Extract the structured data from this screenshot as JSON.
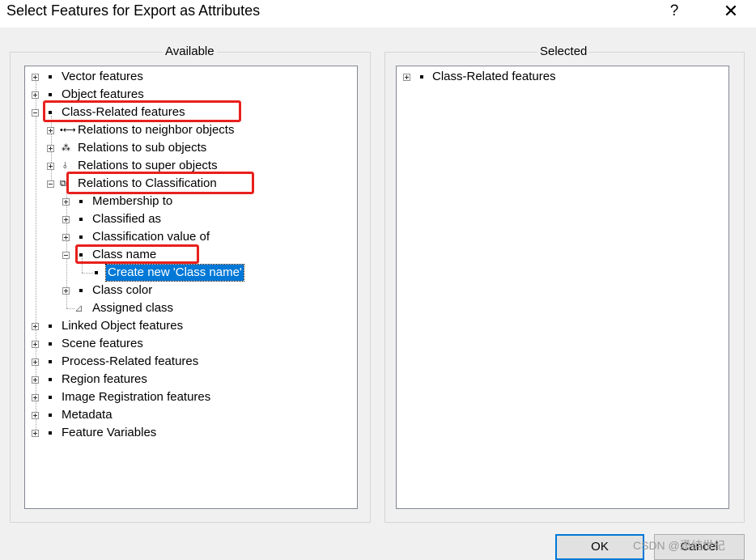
{
  "window": {
    "title": "Select Features for Export as Attributes",
    "help_label": "?",
    "close_label": "✕"
  },
  "available": {
    "legend": "Available",
    "items": [
      {
        "label": "Vector features"
      },
      {
        "label": "Object features"
      },
      {
        "label": "Class-Related features"
      },
      {
        "label": "Relations to neighbor objects"
      },
      {
        "label": "Relations to sub objects"
      },
      {
        "label": "Relations to super objects"
      },
      {
        "label": "Relations to Classification"
      },
      {
        "label": "Membership to"
      },
      {
        "label": "Classified as"
      },
      {
        "label": "Classification value of"
      },
      {
        "label": "Class name"
      },
      {
        "label": "Create new 'Class name'"
      },
      {
        "label": "Class color"
      },
      {
        "label": "Assigned class"
      },
      {
        "label": "Linked Object features"
      },
      {
        "label": "Scene features"
      },
      {
        "label": "Process-Related features"
      },
      {
        "label": "Region features"
      },
      {
        "label": "Image Registration features"
      },
      {
        "label": "Metadata"
      },
      {
        "label": "Feature Variables"
      }
    ]
  },
  "selected": {
    "legend": "Selected",
    "items": [
      {
        "label": "Class-Related features"
      }
    ]
  },
  "buttons": {
    "ok_label": "OK",
    "cancel_label": "Cancel"
  },
  "watermark": "CSDN @潇纯世纪",
  "colors": {
    "selection": "#0078d7",
    "highlight_box": "#e8201c"
  }
}
